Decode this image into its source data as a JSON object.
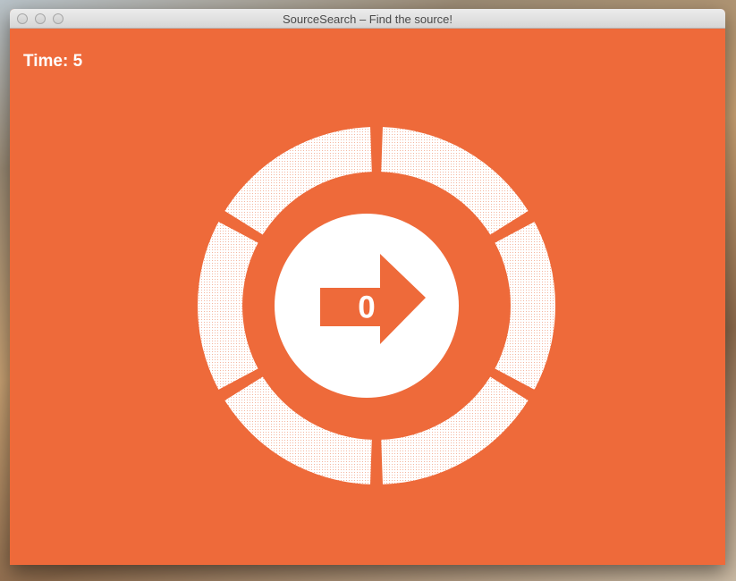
{
  "window": {
    "title": "SourceSearch – Find the source!"
  },
  "game": {
    "timer_label": "Time:",
    "timer_value": "5",
    "score": "0",
    "center_icon": "arrow-right-icon",
    "segments": 6
  },
  "colors": {
    "background": "#ee6a3a",
    "foreground": "#ffffff"
  }
}
